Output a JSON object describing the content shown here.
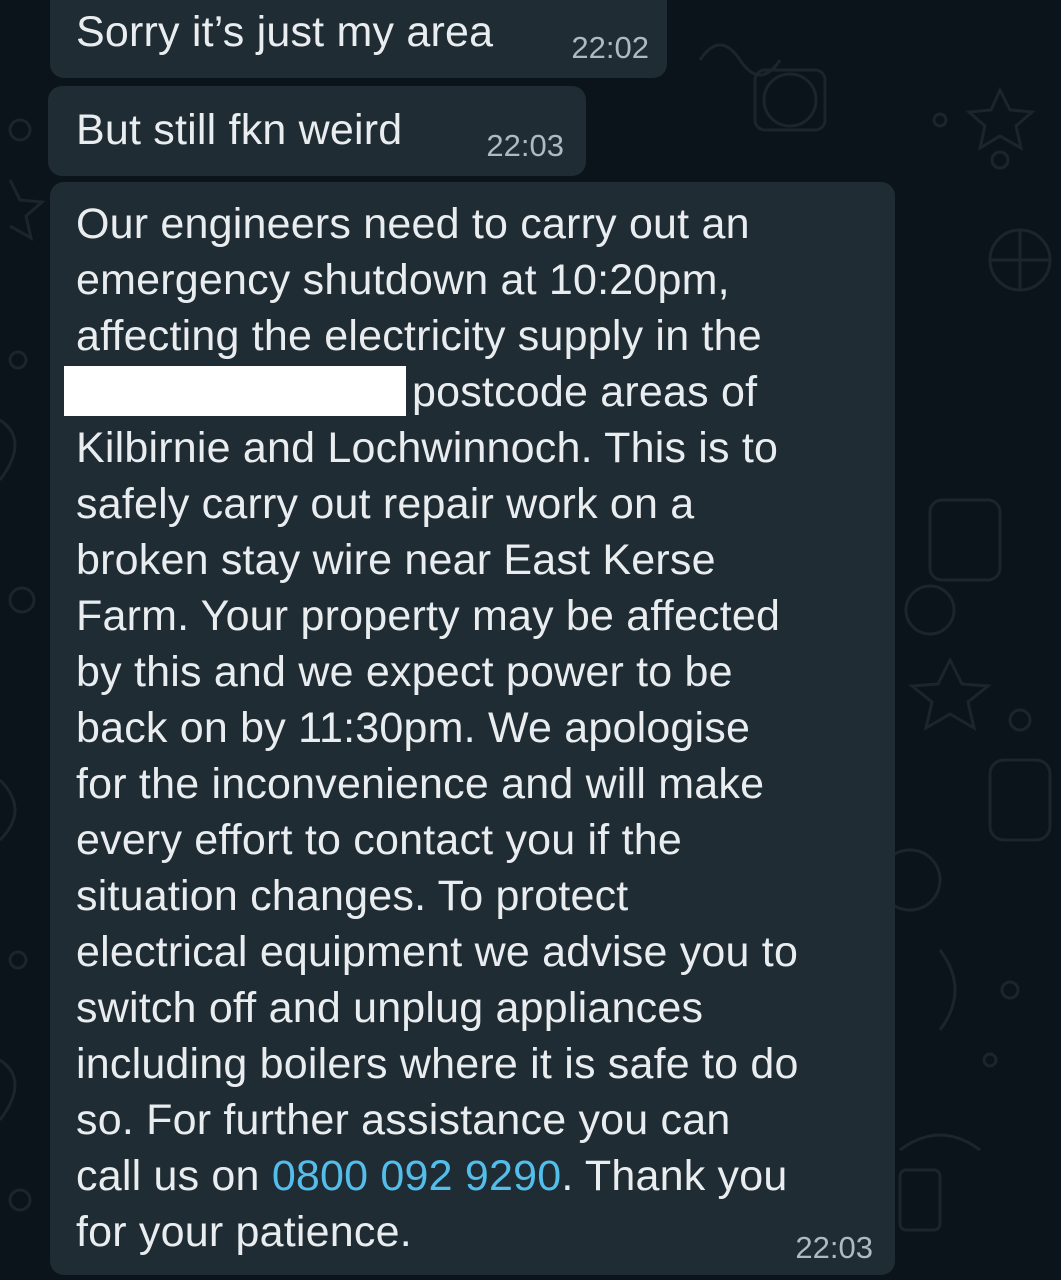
{
  "messages": [
    {
      "text": "Sorry it’s just my area",
      "time": "22:02"
    },
    {
      "text": "But still fkn weird",
      "time": "22:03"
    },
    {
      "lines": [
        "Our engineers need to carry out an",
        "emergency shutdown at 10:20pm,",
        "affecting the electricity supply in the",
        "postcode areas of",
        "Kilbirnie and Lochwinnoch. This is to",
        "safely carry out repair work on a",
        "broken stay wire near East Kerse",
        "Farm. Your property may be affected",
        "by this and we expect power to be",
        "back on by 11:30pm. We apologise",
        "for the inconvenience and will make",
        "every effort to contact you if the",
        "situation changes. To protect",
        "electrical equipment we advise you to",
        "switch off and unplug appliances",
        "including boilers where it is safe to do",
        "so. For further assistance you can",
        "call us on ",
        "0800 092 9290",
        ". Thank you",
        "for your patience."
      ],
      "time": "22:03"
    }
  ],
  "colors": {
    "background": "#0b141a",
    "bubble": "#202c33",
    "text": "#e9edef",
    "timestamp": "#aebac1",
    "link": "#53bdeb"
  },
  "icons": [
    "wallpaper-doodle-pattern"
  ]
}
